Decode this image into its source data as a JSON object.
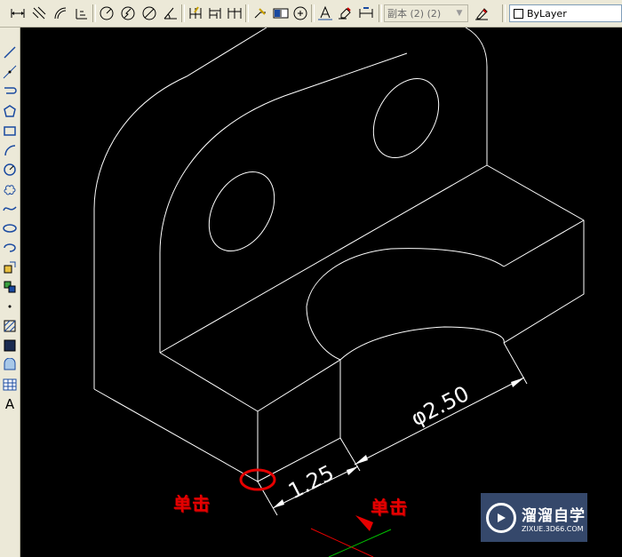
{
  "toolbar": {
    "dim_style_combo": "副本 (2) (2)",
    "layer_combo": "ByLayer"
  },
  "drawing": {
    "dim_diameter": "φ2.50",
    "dim_linear": "1.25"
  },
  "annotations": {
    "click_left": "单击",
    "click_right": "单击"
  },
  "watermark": {
    "brand": "溜溜自学",
    "url": "ZIXUE.3D66.COM"
  },
  "colors": {
    "canvas": "#000000",
    "geometry": "#ffffff",
    "annotation_red": "#e60000",
    "marker_green": "#00c000"
  }
}
